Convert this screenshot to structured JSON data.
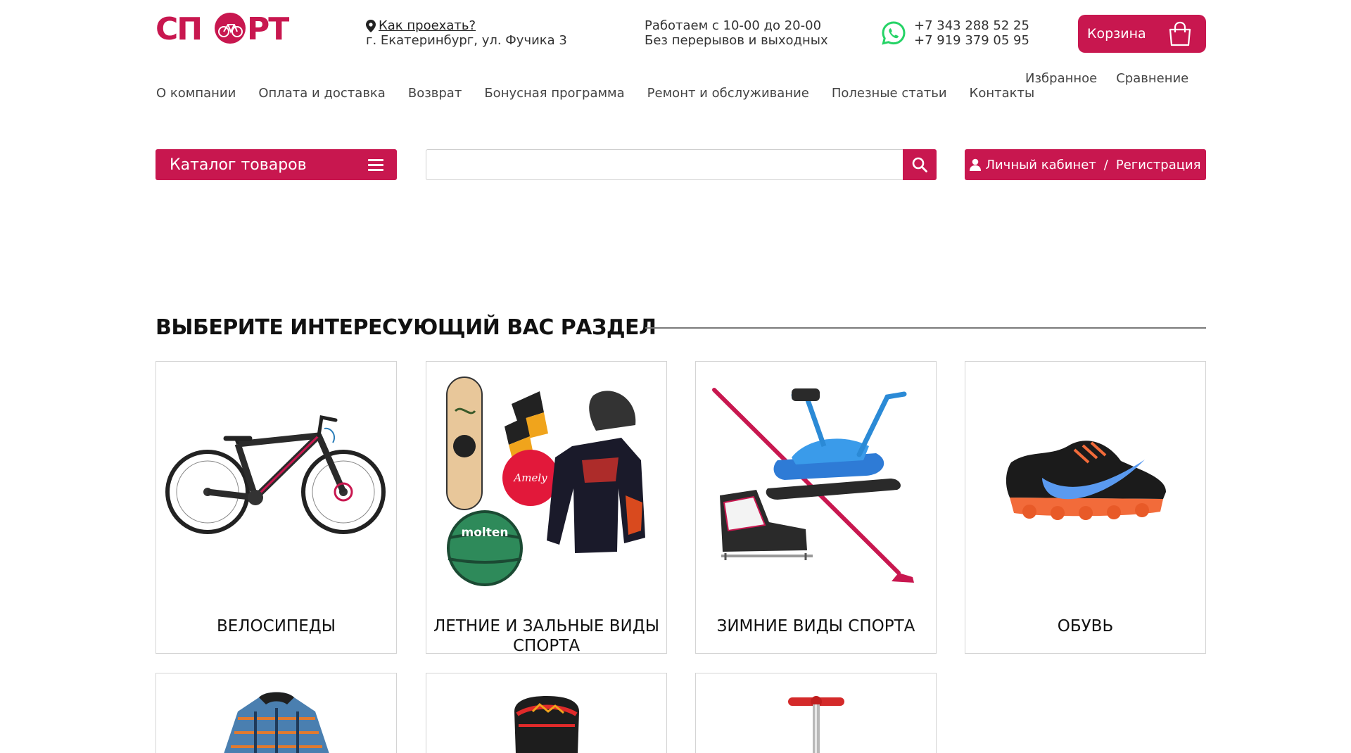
{
  "header": {
    "logo_text": "СПОРТ",
    "directions_link": "Как проехать?",
    "address": "г. Екатеринбург, ул. Фучика 3",
    "hours_line1": "Работаем с 10-00 до 20-00",
    "hours_line2": "Без перерывов и выходных",
    "phone1": "+7 343 288 52 25",
    "phone2": "+7 919 379 05 95",
    "cart_label": "Корзина"
  },
  "nav": {
    "items": [
      {
        "label": "О компании"
      },
      {
        "label": "Оплата и доставка"
      },
      {
        "label": "Возврат"
      },
      {
        "label": "Бонусная программа"
      },
      {
        "label": "Ремонт и обслуживание"
      },
      {
        "label": "Полезные статьи"
      },
      {
        "label": "Контакты"
      }
    ],
    "favorites": "Избранное",
    "compare": "Сравнение"
  },
  "toolbar": {
    "catalog_label": "Каталог товаров",
    "search_placeholder": "",
    "account_label": "Личный кабинет",
    "separator": "/",
    "register_label": "Регистрация"
  },
  "section": {
    "title": "ВЫБЕРИТЕ ИНТЕРЕСУЮЩИЙ ВАС РАЗДЕЛ"
  },
  "categories": [
    {
      "label": "Велосипеды",
      "icon": "bicycle-image"
    },
    {
      "label": "Летние и зальные виды спорта",
      "icon": "summer-sports-image"
    },
    {
      "label": "Зимние виды спорта",
      "icon": "winter-sports-image"
    },
    {
      "label": "Обувь",
      "icon": "sneaker-image"
    },
    {
      "label": "",
      "icon": "jacket-image"
    },
    {
      "label": "",
      "icon": "backpack-image"
    },
    {
      "label": "",
      "icon": "scooter-image"
    }
  ],
  "colors": {
    "accent": "#c8174f",
    "whatsapp": "#25d366"
  }
}
